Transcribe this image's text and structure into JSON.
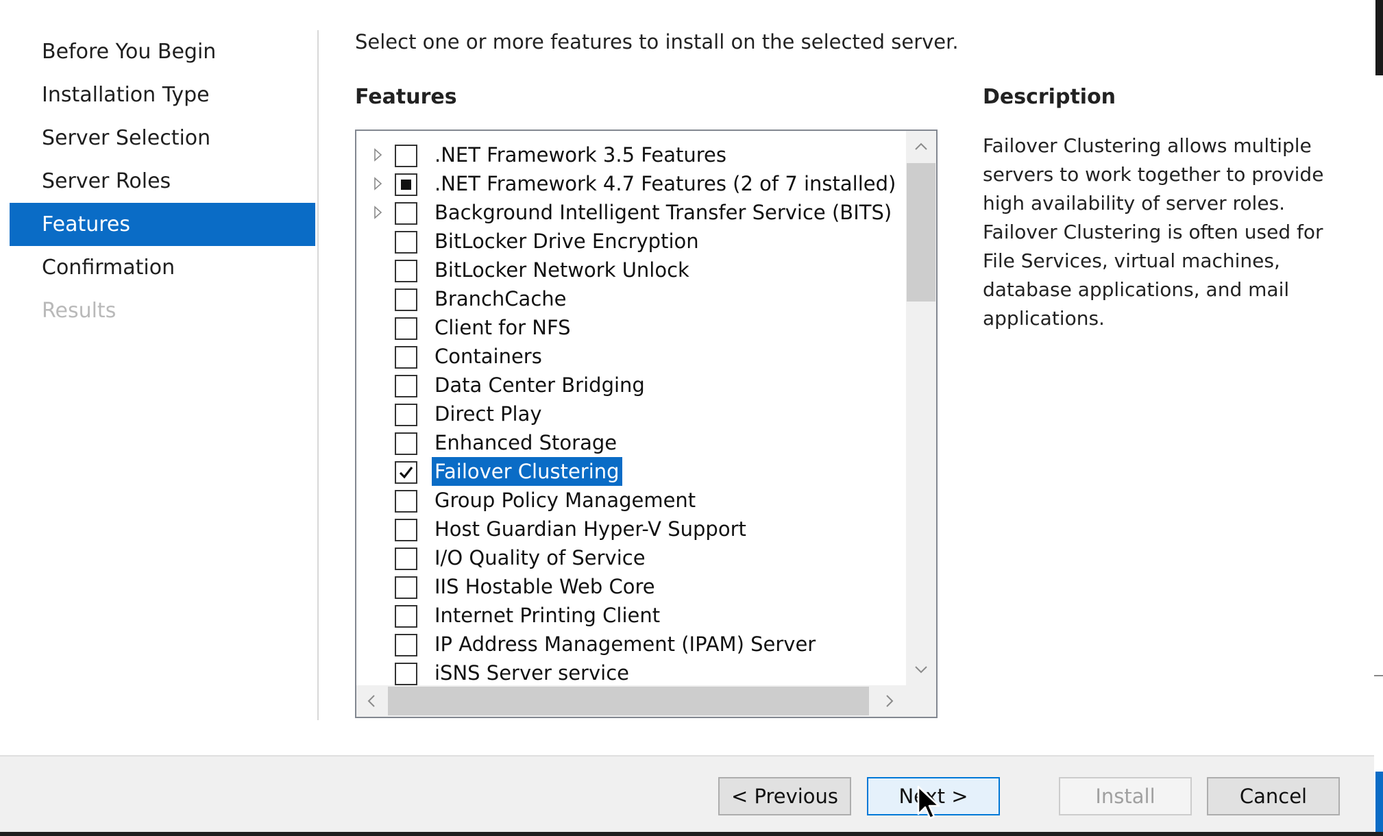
{
  "nav": {
    "items": [
      {
        "label": "Before You Begin",
        "state": "normal"
      },
      {
        "label": "Installation Type",
        "state": "normal"
      },
      {
        "label": "Server Selection",
        "state": "normal"
      },
      {
        "label": "Server Roles",
        "state": "normal"
      },
      {
        "label": "Features",
        "state": "active"
      },
      {
        "label": "Confirmation",
        "state": "normal"
      },
      {
        "label": "Results",
        "state": "disabled"
      }
    ]
  },
  "main": {
    "instruction": "Select one or more features to install on the selected server.",
    "features_heading": "Features",
    "description_heading": "Description",
    "description_text": "Failover Clustering allows multiple servers to work together to provide high availability of server roles. Failover Clustering is often used for File Services, virtual machines, database applications, and mail applications."
  },
  "features": [
    {
      "label": ".NET Framework 3.5 Features",
      "state": "unchecked",
      "expandable": true,
      "selected": false
    },
    {
      "label": ".NET Framework 4.7 Features (2 of 7 installed)",
      "state": "partial",
      "expandable": true,
      "selected": false
    },
    {
      "label": "Background Intelligent Transfer Service (BITS)",
      "state": "unchecked",
      "expandable": true,
      "selected": false
    },
    {
      "label": "BitLocker Drive Encryption",
      "state": "unchecked",
      "expandable": false,
      "selected": false
    },
    {
      "label": "BitLocker Network Unlock",
      "state": "unchecked",
      "expandable": false,
      "selected": false
    },
    {
      "label": "BranchCache",
      "state": "unchecked",
      "expandable": false,
      "selected": false
    },
    {
      "label": "Client for NFS",
      "state": "unchecked",
      "expandable": false,
      "selected": false
    },
    {
      "label": "Containers",
      "state": "unchecked",
      "expandable": false,
      "selected": false
    },
    {
      "label": "Data Center Bridging",
      "state": "unchecked",
      "expandable": false,
      "selected": false
    },
    {
      "label": "Direct Play",
      "state": "unchecked",
      "expandable": false,
      "selected": false
    },
    {
      "label": "Enhanced Storage",
      "state": "unchecked",
      "expandable": false,
      "selected": false
    },
    {
      "label": "Failover Clustering",
      "state": "checked",
      "expandable": false,
      "selected": true
    },
    {
      "label": "Group Policy Management",
      "state": "unchecked",
      "expandable": false,
      "selected": false
    },
    {
      "label": "Host Guardian Hyper-V Support",
      "state": "unchecked",
      "expandable": false,
      "selected": false
    },
    {
      "label": "I/O Quality of Service",
      "state": "unchecked",
      "expandable": false,
      "selected": false
    },
    {
      "label": "IIS Hostable Web Core",
      "state": "unchecked",
      "expandable": false,
      "selected": false
    },
    {
      "label": "Internet Printing Client",
      "state": "unchecked",
      "expandable": false,
      "selected": false
    },
    {
      "label": "IP Address Management (IPAM) Server",
      "state": "unchecked",
      "expandable": false,
      "selected": false
    },
    {
      "label": "iSNS Server service",
      "state": "unchecked",
      "expandable": false,
      "selected": false
    }
  ],
  "footer": {
    "previous_label": "< Previous",
    "next_label": "Next >",
    "install_label": "Install",
    "cancel_label": "Cancel"
  },
  "colors": {
    "accent": "#0a6cc6",
    "disabled_text": "#b9b9b9"
  }
}
